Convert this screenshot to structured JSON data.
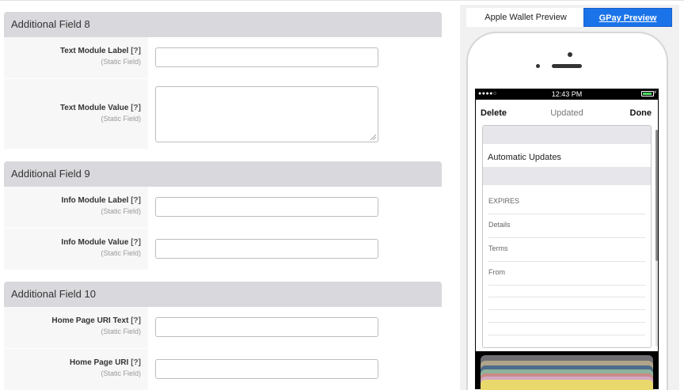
{
  "sections": [
    {
      "title": "Additional Field 8",
      "fields": [
        {
          "label": "Text Module Label",
          "help": "[?]",
          "sublabel": "(Static Field)",
          "type": "input",
          "value": ""
        },
        {
          "label": "Text Module Value",
          "help": "[?]",
          "sublabel": "(Static Field)",
          "type": "textarea",
          "value": ""
        }
      ]
    },
    {
      "title": "Additional Field 9",
      "fields": [
        {
          "label": "Info Module Label",
          "help": "[?]",
          "sublabel": "(Static Field)",
          "type": "input",
          "value": ""
        },
        {
          "label": "Info Module Value",
          "help": "[?]",
          "sublabel": "(Static Field)",
          "type": "input",
          "value": ""
        }
      ]
    },
    {
      "title": "Additional Field 10",
      "fields": [
        {
          "label": "Home Page URI Text",
          "help": "[?]",
          "sublabel": "(Static Field)",
          "type": "input",
          "value": ""
        },
        {
          "label": "Home Page URI",
          "help": "[?]",
          "sublabel": "(Static Field)",
          "type": "input",
          "value": ""
        }
      ]
    }
  ],
  "preview": {
    "tabs": {
      "apple": "Apple Wallet Preview",
      "gpay": "GPay Preview"
    },
    "status_bar": {
      "signal": "●●●●○",
      "time": "12:43 PM",
      "battery_icon": "battery-icon"
    },
    "nav": {
      "delete": "Delete",
      "updated": "Updated",
      "done": "Done"
    },
    "automatic_updates": "Automatic Updates",
    "details": [
      "EXPIRES",
      "Details",
      "Terms",
      "From"
    ]
  },
  "colors": {
    "accent_blue": "#1a73e8",
    "section_header": "#d9d9dd",
    "battery_green": "#4cd964",
    "wallet_cards": [
      "#6e6e73",
      "#b0a58a",
      "#4d6b8a",
      "#8fb29c",
      "#c98a86",
      "#d3a9c2",
      "#e9d86b"
    ]
  }
}
